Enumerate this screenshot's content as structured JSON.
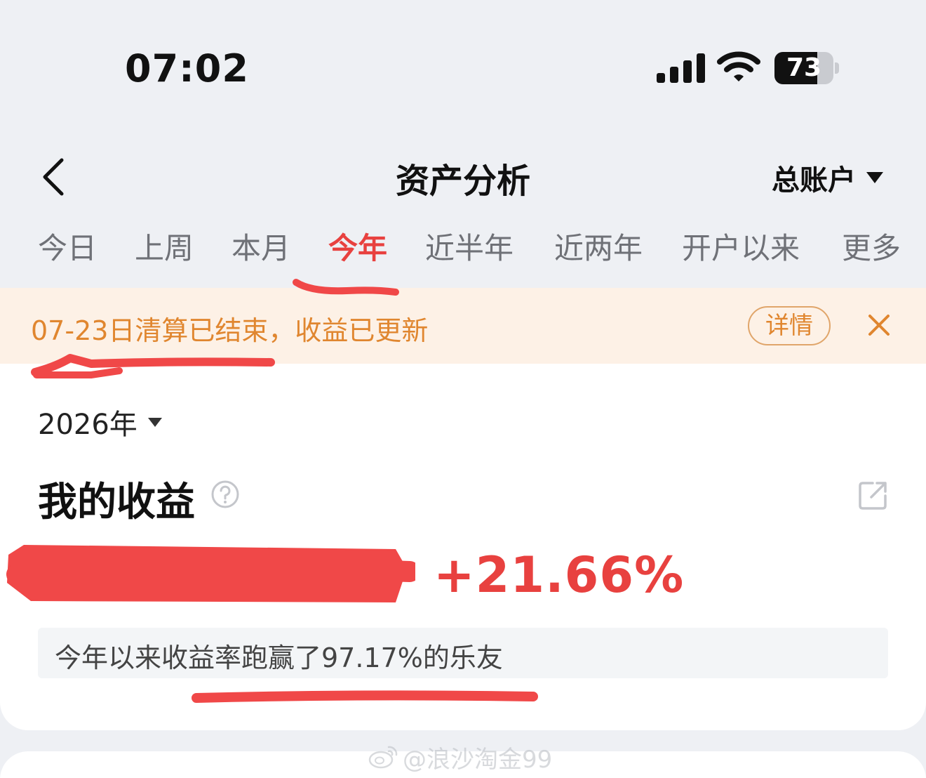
{
  "status_bar": {
    "time": "07:02",
    "battery_level": "73",
    "battery_fraction": 0.73,
    "icons": [
      "signal-icon",
      "wifi-icon",
      "battery-icon"
    ]
  },
  "nav": {
    "title": "资产分析",
    "account": "总账户",
    "icons": [
      "chevron-left-icon",
      "triangle-down-icon"
    ]
  },
  "tabs": [
    {
      "label": "今日",
      "active": false
    },
    {
      "label": "上周",
      "active": false
    },
    {
      "label": "本月",
      "active": false
    },
    {
      "label": "今年",
      "active": true
    },
    {
      "label": "近半年",
      "active": false
    },
    {
      "label": "近两年",
      "active": false
    },
    {
      "label": "开户以来",
      "active": false
    },
    {
      "label": "更多",
      "active": false
    }
  ],
  "notice": {
    "text": "07-23日清算已结束，收益已更新",
    "detail_button": "详情",
    "icons": [
      "close-icon"
    ]
  },
  "earnings": {
    "year": "2026年",
    "title": "我的收益",
    "return_rate": "+21.66%",
    "ranking_text": "今年以来收益率跑赢了97.17%的乐友",
    "icons": [
      "help-icon",
      "share-icon"
    ]
  },
  "watermark": {
    "text": "@浪沙淘金99",
    "icons": [
      "weibo-logo-icon"
    ]
  },
  "colors": {
    "accent": "#e8413f",
    "notice_text": "#e0862f",
    "notice_bg": "#fdf1e6",
    "page_bg": "#eef0f4",
    "annotation": "#f04848"
  }
}
